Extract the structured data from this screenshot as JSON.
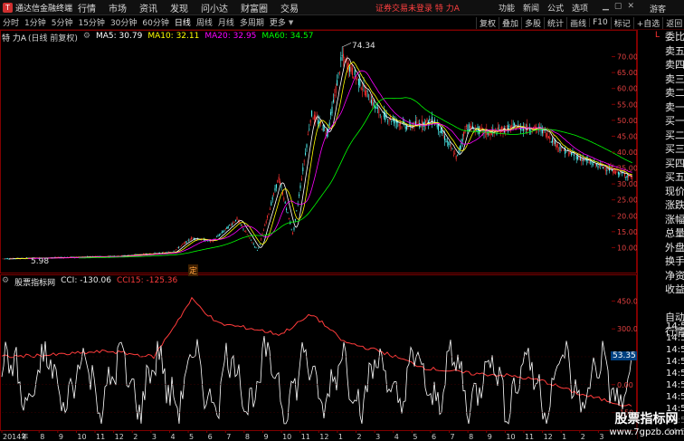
{
  "menubar": {
    "logo_text": "通达信金融终端",
    "items": [
      "行情",
      "市场",
      "资讯",
      "发现",
      "问小达",
      "财富圈",
      "交易"
    ],
    "alert": "证券交易未登录  特 力A",
    "right_items": [
      "功能",
      "新闻",
      "公式",
      "选项"
    ],
    "guest": "游客"
  },
  "periodbar": {
    "items": [
      "分时",
      "1分钟",
      "5分钟",
      "15分钟",
      "30分钟",
      "60分钟",
      "日线",
      "周线",
      "月线",
      "多周期",
      "更多"
    ],
    "active": "日线",
    "tools": [
      "复权",
      "叠加",
      "多股",
      "统计",
      "画线",
      "F10",
      "标记",
      "+自选",
      "返回"
    ]
  },
  "chart": {
    "stock_title": "特 力A",
    "period_label": "(日线 前复权)",
    "ma5": "MA5: 30.79",
    "ma10": "MA10: 32.11",
    "ma20": "MA20: 32.95",
    "ma60": "MA60: 34.57",
    "high_label": "74.34",
    "low_label": "5.98",
    "marker_label": "定",
    "price_ticks": [
      "70.00",
      "65.00",
      "60.00",
      "55.00",
      "50.00",
      "45.00",
      "40.00",
      "35.00",
      "30.00",
      "25.00",
      "20.00",
      "15.00",
      "10.00"
    ],
    "price_tick_values": [
      70,
      65,
      60,
      55,
      50,
      45,
      40,
      35,
      30,
      25,
      20,
      15,
      10
    ],
    "colors": {
      "up": "#ff3232",
      "down": "#54ffff",
      "ma5": "#ffffff",
      "ma10": "#ffff00",
      "ma20": "#ff00ff",
      "ma60": "#00ff00",
      "cci": "#ffffff",
      "ccl15": "#ff3b3b",
      "frame": "#800000"
    }
  },
  "cci": {
    "title": "股票指标网",
    "cci_value": "CCI: -130.06",
    "ccl_value": "CCI15: -125.36",
    "ticks": [
      "450.0",
      "300.0",
      "150.0",
      "0.00",
      "-150.0"
    ],
    "tick_values": [
      450,
      300,
      150,
      0,
      -150
    ],
    "current_label": "53.35"
  },
  "x_axis": {
    "labels": [
      "2014年",
      "7",
      "8",
      "9",
      "10",
      "11",
      "12",
      "2",
      "3",
      "4",
      "5",
      "6",
      "7",
      "8",
      "9",
      "10",
      "11",
      "12",
      "1",
      "2",
      "3",
      "4",
      "5",
      "6",
      "7",
      "8",
      "9",
      "10",
      "11",
      "12",
      "1",
      "2",
      "3"
    ]
  },
  "side_panel": {
    "rows": [
      "委比",
      "卖五",
      "卖四",
      "卖三",
      "卖二",
      "卖一",
      "买一",
      "买二",
      "买三",
      "买四",
      "买五",
      "现价",
      "涨跌",
      "涨幅",
      "总量",
      "外盘",
      "换手",
      "净资",
      "收益",
      "",
      "自动",
      "行情"
    ],
    "time_rows": [
      "14:5",
      "14:5",
      "14:5",
      "14:5",
      "14:5",
      "14:5",
      "14:5",
      "14:5",
      "14:5",
      "14:5"
    ]
  },
  "watermark": {
    "main": "股票指标网",
    "sub": "www.7gpzb.com"
  }
}
